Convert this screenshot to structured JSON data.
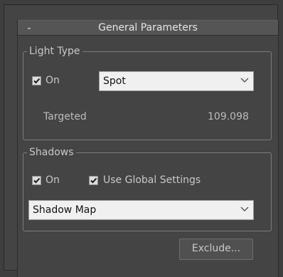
{
  "rollout": {
    "collapse_symbol": "-",
    "title": "General Parameters"
  },
  "light_type": {
    "title": "Light Type",
    "on_label": "On",
    "on_checked": true,
    "type_value": "Spot",
    "targeted_label": "Targeted",
    "targeted_distance": "109.098"
  },
  "shadows": {
    "title": "Shadows",
    "on_label": "On",
    "on_checked": true,
    "use_global_label": "Use Global Settings",
    "use_global_checked": true,
    "type_value": "Shadow Map"
  },
  "exclude_button": {
    "label": "Exclude..."
  },
  "icons": {
    "checkmark": "checkmark-icon",
    "dropdown_arrow": "chevron-down-icon"
  }
}
